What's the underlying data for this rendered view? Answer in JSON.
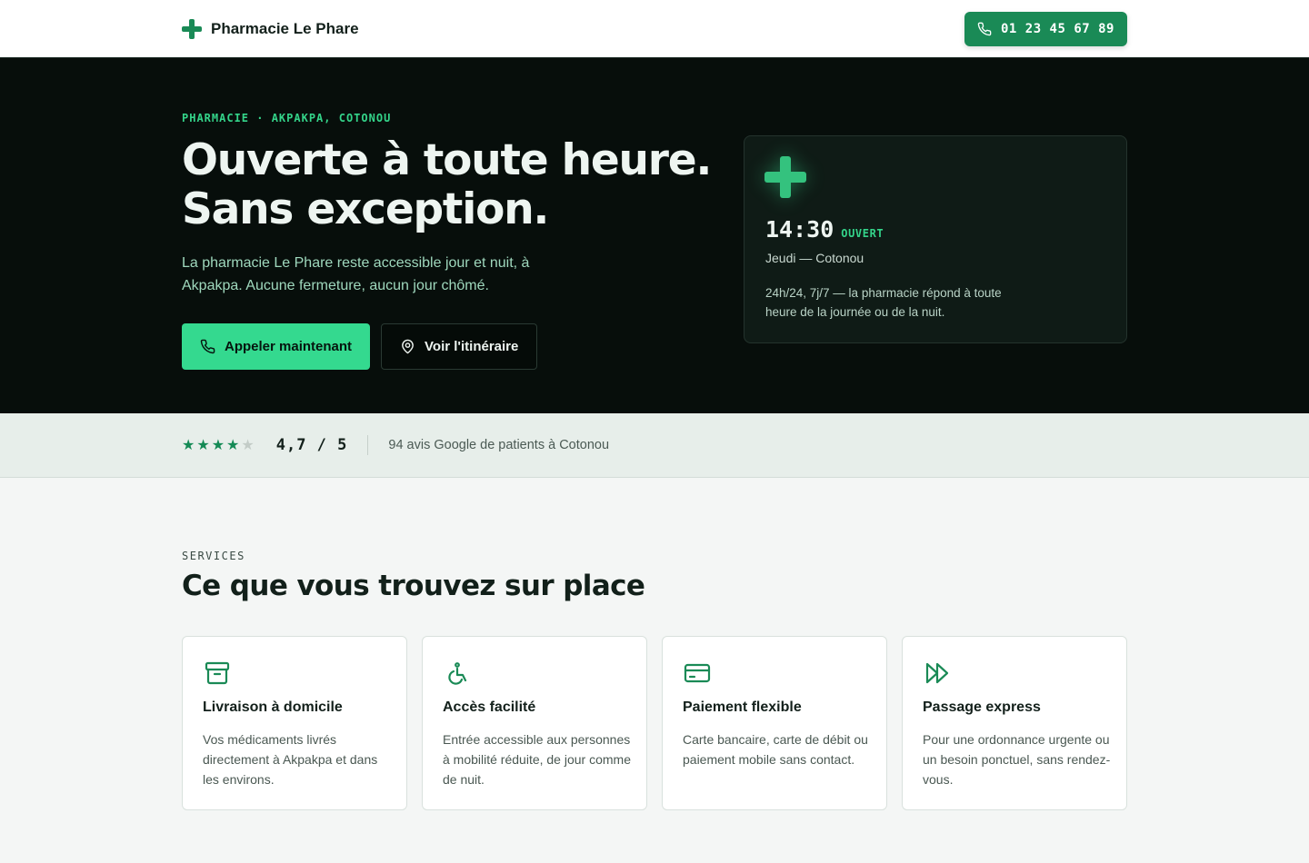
{
  "header": {
    "brand_name": "Pharmacie Le Phare",
    "brand_icon": "cross-icon",
    "phone_label": "01 23 45 67 89",
    "phone_icon": "phone-icon"
  },
  "hero": {
    "eyebrow": "PHARMACIE · AKPAKPA, COTONOU",
    "title_line1": "Ouverte à toute heure.",
    "title_line2": "Sans exception.",
    "lead": "La pharmacie Le Phare reste accessible jour et nuit, à Akpakpa. Aucune fermeture, aucun jour chômé.",
    "primary_button": "Appeler maintenant",
    "secondary_button": "Voir l'itinéraire",
    "status_card": {
      "time": "14:30",
      "status": "OUVERT",
      "day": "Jeudi — Cotonou",
      "note": "24h/24, 7j/7 — la pharmacie répond à toute heure de la journée ou de la nuit."
    }
  },
  "rating": {
    "stars_value": 4.7,
    "stars_max": 5,
    "score": "4,7 / 5",
    "reviews": "94 avis Google de patients à Cotonou"
  },
  "services": {
    "label": "SERVICES",
    "title": "Ce que vous trouvez sur place",
    "cards": [
      {
        "icon": "delivery-box-icon",
        "title": "Livraison à domicile",
        "desc": "Vos médicaments livrés directement à Akpakpa et dans les environs."
      },
      {
        "icon": "wheelchair-icon",
        "title": "Accès facilité",
        "desc": "Entrée accessible aux personnes à mobilité réduite, de jour comme de nuit."
      },
      {
        "icon": "credit-card-icon",
        "title": "Paiement flexible",
        "desc": "Carte bancaire, carte de débit ou paiement mobile sans contact."
      },
      {
        "icon": "fast-forward-icon",
        "title": "Passage express",
        "desc": "Pour une ordonnance urgente ou un besoin ponctuel, sans rendez-vous."
      }
    ]
  },
  "colors": {
    "brand_green": "#1a8a56",
    "accent_green": "#34d98f",
    "hero_bg": "#070e0b"
  }
}
